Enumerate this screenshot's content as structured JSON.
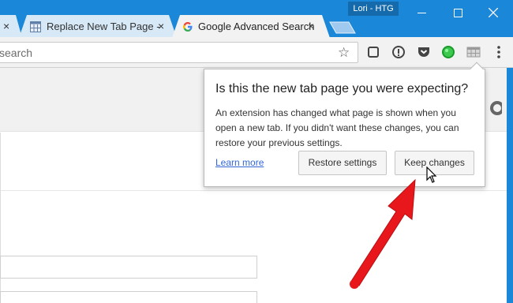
{
  "tabs": [
    {
      "label": "",
      "close": "×"
    },
    {
      "label": "Replace New Tab Page -",
      "close": "×"
    },
    {
      "label": "Google Advanced Search",
      "close": "×"
    }
  ],
  "profile": {
    "label": "Lori - HTG"
  },
  "window": {
    "minimize": "—",
    "maximize": "☐",
    "close": "✕"
  },
  "omnibox": {
    "text": "search",
    "star": "☆"
  },
  "toolbar_icons": [
    "stop-square-icon",
    "info-circle-icon",
    "pocket-icon",
    "green-dot-extension-icon",
    "grid-extension-icon",
    "more-menu-icon"
  ],
  "popup": {
    "title": "Is this the new tab page you were expecting?",
    "body": "An extension has changed what page is shown when you open a new tab. If you didn't want these changes, you can restore your previous settings.",
    "learn_more": "Learn more",
    "restore": "Restore settings",
    "keep": "Keep changes"
  },
  "colors": {
    "titlebar": "#1a87d8",
    "arrow": "#e8171b",
    "link": "#3367d6"
  }
}
